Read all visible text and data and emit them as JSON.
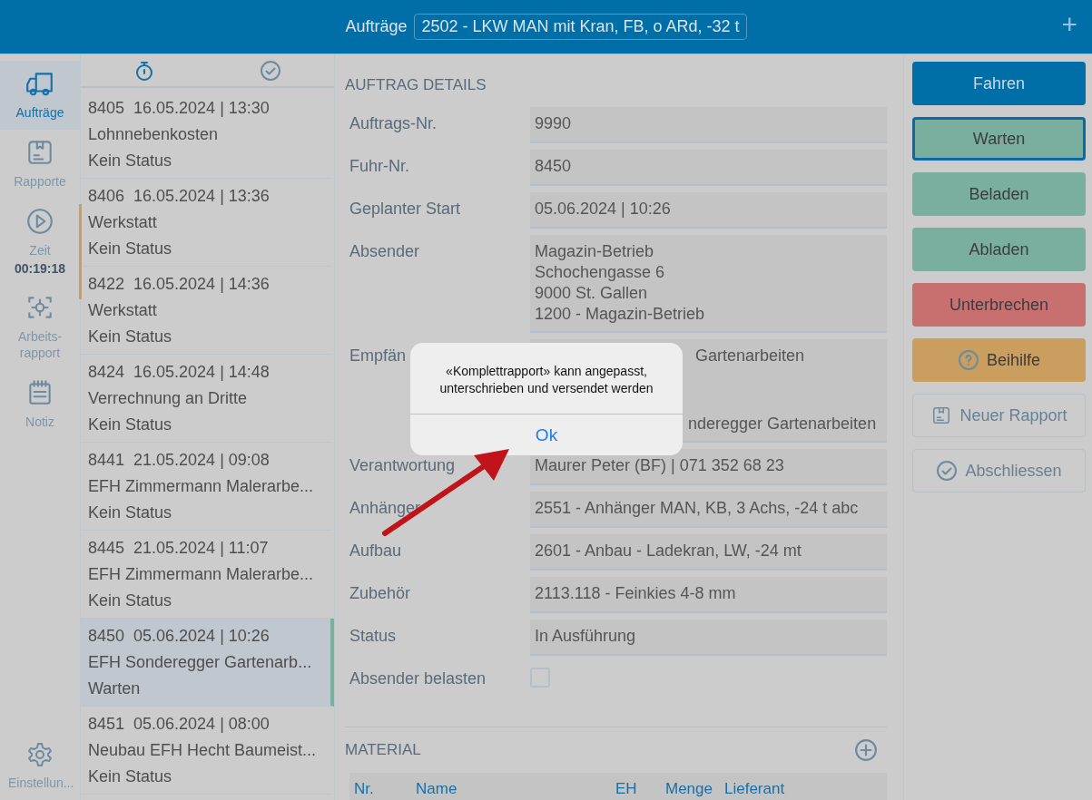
{
  "header": {
    "title": "Aufträge",
    "selector": "2502 - LKW MAN mit Kran, FB, o ARd, -32 t",
    "add": "+"
  },
  "nav": {
    "items": [
      {
        "label": "Aufträge",
        "kind": "truck",
        "selected": true
      },
      {
        "label": "Rapporte",
        "kind": "report",
        "selected": false
      },
      {
        "label": "Zeit",
        "kind": "timer",
        "sub": "00:19:18",
        "selected": false
      },
      {
        "label": "Arbeits-rapport",
        "kind": "scan",
        "selected": false
      },
      {
        "label": "Notiz",
        "kind": "note",
        "selected": false
      }
    ],
    "settings": {
      "label": "Einstellun..."
    }
  },
  "list_tabs": [
    {
      "kind": "running",
      "selected": true
    },
    {
      "kind": "done",
      "selected": false
    }
  ],
  "orders": [
    {
      "heading": "8405  16.05.2024 | 13:30",
      "title": "Lohnnebenkosten",
      "status": "Kein Status",
      "selected": false
    },
    {
      "heading": "8406  16.05.2024 | 13:36",
      "title": "Werkstatt",
      "status": "Kein Status",
      "selected": false
    },
    {
      "heading": "8422  16.05.2024 | 14:36",
      "title": "Werkstatt",
      "status": "Kein Status",
      "selected": false
    },
    {
      "heading": "8424  16.05.2024 | 14:48",
      "title": "Verrechnung an Dritte",
      "status": "Kein Status",
      "selected": false
    },
    {
      "heading": "8441  21.05.2024 | 09:08",
      "title": "EFH Zimmermann Malerarbe...",
      "status": "Kein Status",
      "selected": false
    },
    {
      "heading": "8445  21.05.2024 | 11:07",
      "title": "EFH Zimmermann Malerarbe...",
      "status": "Kein Status",
      "selected": false
    },
    {
      "heading": "8450  05.06.2024 | 10:26",
      "title": "EFH Sonderegger Gartenarb...",
      "status": "Warten",
      "selected": true
    },
    {
      "heading": "8451  05.06.2024 | 08:00",
      "title": "Neubau EFH Hecht Baumeist...",
      "status": "Kein Status",
      "selected": false
    }
  ],
  "details": {
    "title": "AUFTRAG DETAILS",
    "fields": [
      {
        "kind": "text",
        "label": "Auftrags-Nr.",
        "lines": [
          "9990"
        ]
      },
      {
        "kind": "text",
        "label": "Fuhr-Nr.",
        "lines": [
          "8450"
        ]
      },
      {
        "kind": "text",
        "label": "Geplanter Start",
        "lines": [
          "05.06.2024 | 10:26"
        ]
      },
      {
        "kind": "text",
        "label": "Absender",
        "lines": [
          "Magazin-Betrieb",
          "Schochengasse 6",
          "9000 St. Gallen",
          "1200 - Magazin-Betrieb"
        ]
      },
      {
        "kind": "covered",
        "label": "Empfän",
        "lines": [
          "Gartenarbeiten",
          "nderegger Gartenarbeiten"
        ]
      },
      {
        "kind": "text",
        "label": "Verantwortung",
        "lines": [
          "Maurer Peter (BF) | 071 352 68 23"
        ]
      },
      {
        "kind": "text",
        "label": "Anhänger",
        "lines": [
          "2551 - Anhänger MAN, KB, 3 Achs, -24 t abc"
        ]
      },
      {
        "kind": "text",
        "label": "Aufbau",
        "lines": [
          "2601 - Anbau - Ladekran, LW, -24 mt"
        ]
      },
      {
        "kind": "text",
        "label": "Zubehör",
        "lines": [
          "2113.118 - Feinkies 4-8 mm"
        ]
      },
      {
        "kind": "text",
        "label": "Status",
        "lines": [
          "In Ausführung"
        ]
      },
      {
        "kind": "checkbox",
        "label": "Absender belasten",
        "checked": false
      }
    ]
  },
  "material": {
    "title": "MATERIAL",
    "columns": [
      "Nr.",
      "Name",
      "EH",
      "Menge",
      "Lieferant"
    ]
  },
  "actions": [
    {
      "label": "Fahren",
      "kind": "primary",
      "selected": false
    },
    {
      "label": "Warten",
      "kind": "state",
      "selected": true
    },
    {
      "label": "Beladen",
      "kind": "state",
      "selected": false
    },
    {
      "label": "Abladen",
      "kind": "state",
      "selected": false
    },
    {
      "label": "Unterbrechen",
      "kind": "danger",
      "selected": false
    },
    {
      "label": "Beihilfe",
      "kind": "help",
      "selected": false
    },
    {
      "label": "Neuer Rapport",
      "kind": "report",
      "selected": false
    },
    {
      "label": "Abschliessen",
      "kind": "finish",
      "selected": false
    }
  ],
  "dialog": {
    "message": "«Komplettrapport» kann angepasst, unterschrieben und versendet werden",
    "button": "Ok"
  }
}
